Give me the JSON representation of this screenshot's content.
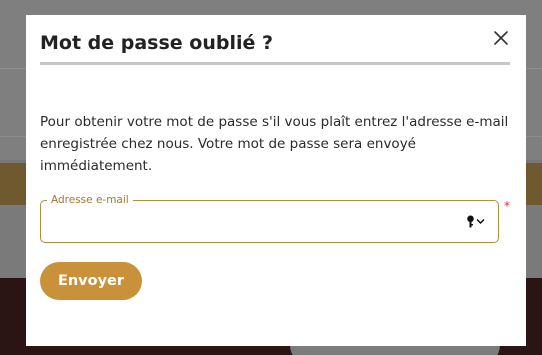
{
  "modal": {
    "title": "Mot de passe oublié ?",
    "description": "Pour obtenir votre mot de passe s'il vous plaît entrez l'adresse e-mail enregistrée chez nous. Votre mot de passe sera envoyé immédiatement.",
    "email_field": {
      "label": "Adresse e-mail",
      "value": "",
      "required_mark": "*"
    },
    "submit_label": "Envoyer",
    "close_icon": "close-icon",
    "autofill_icon": "key-icon"
  },
  "colors": {
    "accent": "#c9923a",
    "field_border": "#b88c3a",
    "required": "#dd3333"
  }
}
